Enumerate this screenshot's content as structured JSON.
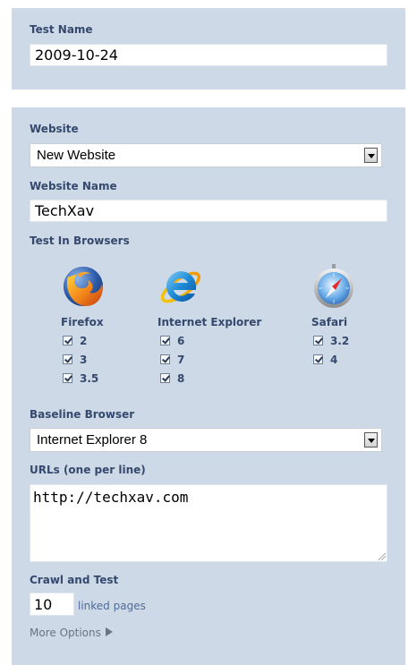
{
  "test_name": {
    "label": "Test Name",
    "value": "2009-10-24"
  },
  "website": {
    "label": "Website",
    "selected": "New Website"
  },
  "website_name": {
    "label": "Website Name",
    "value": "TechXav"
  },
  "browsers": {
    "label": "Test In Browsers",
    "items": [
      {
        "name": "Firefox",
        "icon": "firefox-icon",
        "versions": [
          "2",
          "3",
          "3.5"
        ],
        "checked": [
          true,
          true,
          true
        ]
      },
      {
        "name": "Internet Explorer",
        "icon": "internet-explorer-icon",
        "versions": [
          "6",
          "7",
          "8"
        ],
        "checked": [
          true,
          true,
          true
        ]
      },
      {
        "name": "Safari",
        "icon": "safari-icon",
        "versions": [
          "3.2",
          "4"
        ],
        "checked": [
          true,
          true
        ]
      }
    ]
  },
  "baseline": {
    "label": "Baseline Browser",
    "selected": "Internet Explorer 8"
  },
  "urls": {
    "label": "URLs (one per line)",
    "value": "http://techxav.com"
  },
  "crawl": {
    "label": "Crawl and Test",
    "value": "10",
    "suffix": "linked pages"
  },
  "more_options": {
    "label": "More Options"
  },
  "colors": {
    "panel": "#cdd9e6",
    "label": "#35496e",
    "link": "#4f6c9b"
  }
}
